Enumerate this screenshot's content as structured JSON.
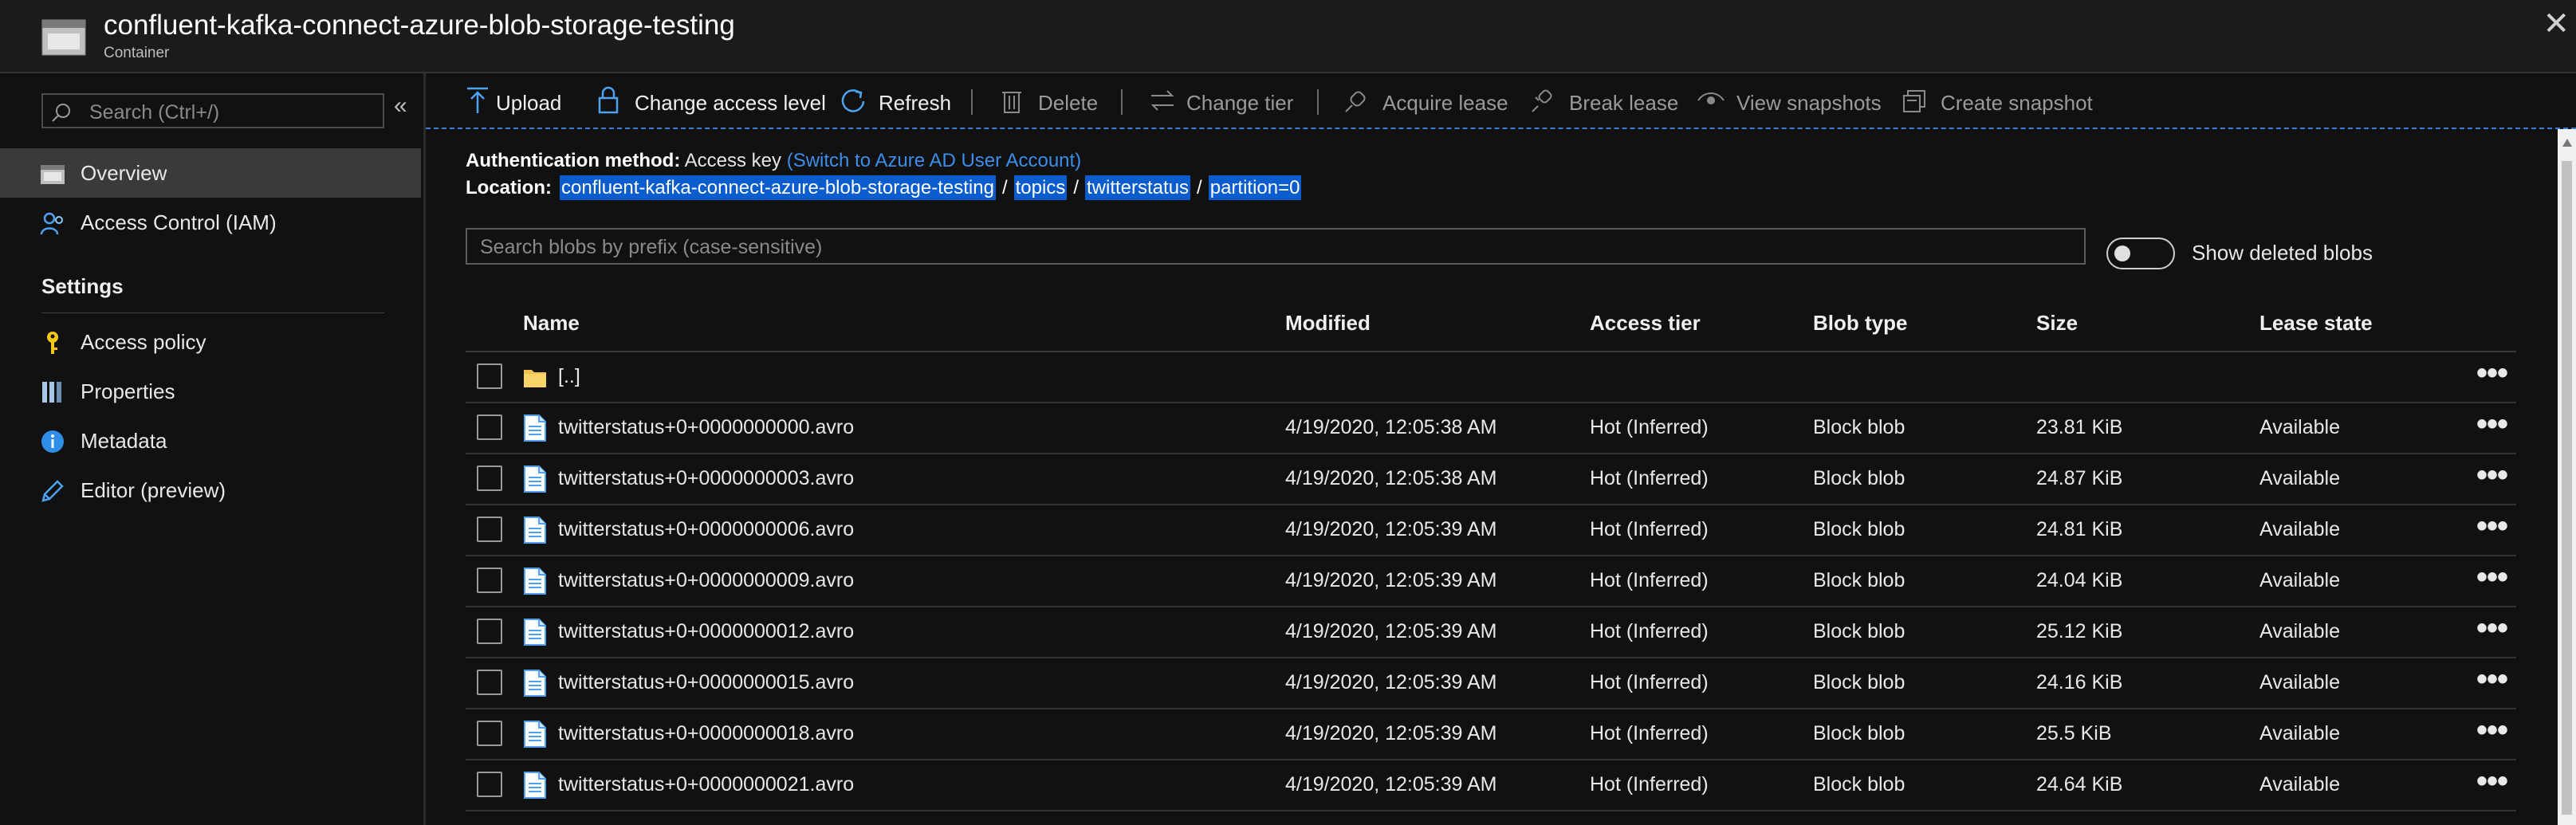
{
  "header": {
    "title": "confluent-kafka-connect-azure-blob-storage-testing",
    "subtitle": "Container",
    "close": "✕"
  },
  "sidebar": {
    "search_placeholder": "Search (Ctrl+/)",
    "collapse": "«",
    "items": [
      {
        "label": "Overview",
        "icon": "container-icon"
      },
      {
        "label": "Access Control (IAM)",
        "icon": "people-icon"
      }
    ],
    "settings_heading": "Settings",
    "settings_items": [
      {
        "label": "Access policy",
        "icon": "key-icon"
      },
      {
        "label": "Properties",
        "icon": "properties-icon"
      },
      {
        "label": "Metadata",
        "icon": "info-icon"
      },
      {
        "label": "Editor (preview)",
        "icon": "pencil-icon"
      }
    ]
  },
  "toolbar": {
    "upload": "Upload",
    "change_access": "Change access level",
    "refresh": "Refresh",
    "delete": "Delete",
    "change_tier": "Change tier",
    "acquire_lease": "Acquire lease",
    "break_lease": "Break lease",
    "view_snapshots": "View snapshots",
    "create_snapshot": "Create snapshot"
  },
  "auth": {
    "label": "Authentication method:",
    "value": "Access key",
    "link": "(Switch to Azure AD User Account)"
  },
  "location": {
    "label": "Location:",
    "crumbs": [
      "confluent-kafka-connect-azure-blob-storage-testing",
      "topics",
      "twitterstatus",
      "partition=0"
    ],
    "separator": "/"
  },
  "blob_search": {
    "placeholder": "Search blobs by prefix (case-sensitive)"
  },
  "show_deleted": {
    "label": "Show deleted blobs"
  },
  "table": {
    "columns": [
      "Name",
      "Modified",
      "Access tier",
      "Blob type",
      "Size",
      "Lease state"
    ],
    "parent": "[..]",
    "more": "•••",
    "rows": [
      {
        "name": "twitterstatus+0+0000000000.avro",
        "modified": "4/19/2020, 12:05:38 AM",
        "tier": "Hot (Inferred)",
        "type": "Block blob",
        "size": "23.81 KiB",
        "lease": "Available"
      },
      {
        "name": "twitterstatus+0+0000000003.avro",
        "modified": "4/19/2020, 12:05:38 AM",
        "tier": "Hot (Inferred)",
        "type": "Block blob",
        "size": "24.87 KiB",
        "lease": "Available"
      },
      {
        "name": "twitterstatus+0+0000000006.avro",
        "modified": "4/19/2020, 12:05:39 AM",
        "tier": "Hot (Inferred)",
        "type": "Block blob",
        "size": "24.81 KiB",
        "lease": "Available"
      },
      {
        "name": "twitterstatus+0+0000000009.avro",
        "modified": "4/19/2020, 12:05:39 AM",
        "tier": "Hot (Inferred)",
        "type": "Block blob",
        "size": "24.04 KiB",
        "lease": "Available"
      },
      {
        "name": "twitterstatus+0+0000000012.avro",
        "modified": "4/19/2020, 12:05:39 AM",
        "tier": "Hot (Inferred)",
        "type": "Block blob",
        "size": "25.12 KiB",
        "lease": "Available"
      },
      {
        "name": "twitterstatus+0+0000000015.avro",
        "modified": "4/19/2020, 12:05:39 AM",
        "tier": "Hot (Inferred)",
        "type": "Block blob",
        "size": "24.16 KiB",
        "lease": "Available"
      },
      {
        "name": "twitterstatus+0+0000000018.avro",
        "modified": "4/19/2020, 12:05:39 AM",
        "tier": "Hot (Inferred)",
        "type": "Block blob",
        "size": "25.5 KiB",
        "lease": "Available"
      },
      {
        "name": "twitterstatus+0+0000000021.avro",
        "modified": "4/19/2020, 12:05:39 AM",
        "tier": "Hot (Inferred)",
        "type": "Block blob",
        "size": "24.64 KiB",
        "lease": "Available"
      }
    ]
  },
  "colors": {
    "accent": "#3c8eea",
    "selection": "#0b5ccc",
    "key": "#f5c518"
  }
}
